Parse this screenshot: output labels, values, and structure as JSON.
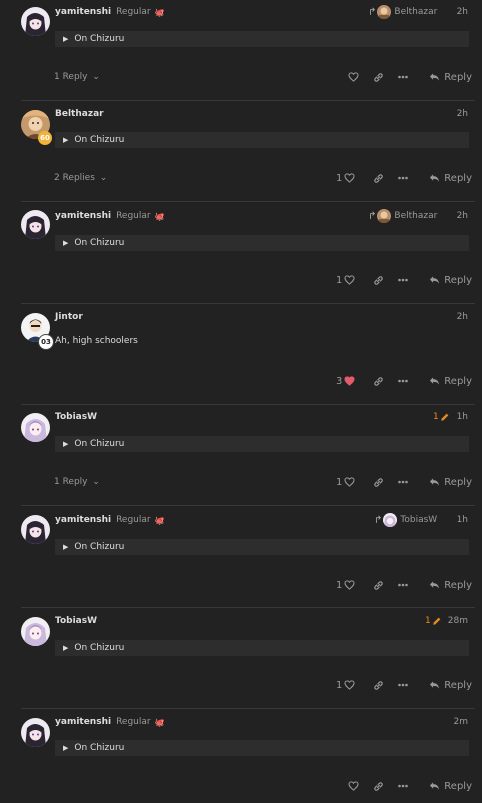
{
  "posts": [
    {
      "username": "yamitenshi",
      "user_title": "Regular",
      "flair": "🐙",
      "reply_to": "Belthazar",
      "edit_count": "",
      "date": "2h",
      "quote_label": "On Chizuru",
      "body": "",
      "replies_label": "1 Reply",
      "like_count": "",
      "liked": false,
      "reply_label": "Reply"
    },
    {
      "username": "Belthazar",
      "user_title": "",
      "flair": "",
      "badge": "60",
      "reply_to": "",
      "edit_count": "",
      "date": "2h",
      "quote_label": "On Chizuru",
      "body": "",
      "replies_label": "2 Replies",
      "like_count": "1",
      "liked": false,
      "reply_label": "Reply"
    },
    {
      "username": "yamitenshi",
      "user_title": "Regular",
      "flair": "🐙",
      "reply_to": "Belthazar",
      "edit_count": "",
      "date": "2h",
      "quote_label": "On Chizuru",
      "body": "",
      "replies_label": "",
      "like_count": "1",
      "liked": false,
      "reply_label": "Reply"
    },
    {
      "username": "Jintor",
      "user_title": "",
      "flair": "",
      "badge": "03",
      "reply_to": "",
      "edit_count": "",
      "date": "2h",
      "quote_label": "",
      "body": "Ah, high schoolers",
      "replies_label": "",
      "like_count": "3",
      "liked": true,
      "reply_label": "Reply"
    },
    {
      "username": "TobiasW",
      "user_title": "",
      "flair": "",
      "reply_to": "",
      "edit_count": "1",
      "date": "1h",
      "quote_label": "On Chizuru",
      "body": "",
      "replies_label": "1 Reply",
      "like_count": "1",
      "liked": false,
      "reply_label": "Reply"
    },
    {
      "username": "yamitenshi",
      "user_title": "Regular",
      "flair": "🐙",
      "reply_to": "TobiasW",
      "edit_count": "",
      "date": "1h",
      "quote_label": "On Chizuru",
      "body": "",
      "replies_label": "",
      "like_count": "1",
      "liked": false,
      "reply_label": "Reply"
    },
    {
      "username": "TobiasW",
      "user_title": "",
      "flair": "",
      "reply_to": "",
      "edit_count": "1",
      "date": "28m",
      "quote_label": "On Chizuru",
      "body": "",
      "replies_label": "",
      "like_count": "1",
      "liked": false,
      "reply_label": "Reply"
    },
    {
      "username": "yamitenshi",
      "user_title": "Regular",
      "flair": "🐙",
      "reply_to": "",
      "edit_count": "",
      "date": "2m",
      "quote_label": "On Chizuru",
      "body": "",
      "replies_label": "",
      "like_count": "",
      "liked": false,
      "reply_label": "Reply"
    }
  ],
  "colors": {
    "background": "#222222",
    "muted": "#9a9a9a",
    "like_active": "#e45b6b",
    "edited": "#e58a21",
    "quote_bg": "#2d2d2d"
  },
  "icons": {
    "like": "heart-icon",
    "link": "link-icon",
    "more": "ellipsis-icon",
    "reply": "reply-arrow-icon",
    "expand": "caret-right-icon",
    "replies_toggle": "chevron-down-icon",
    "edit": "pencil-icon"
  }
}
